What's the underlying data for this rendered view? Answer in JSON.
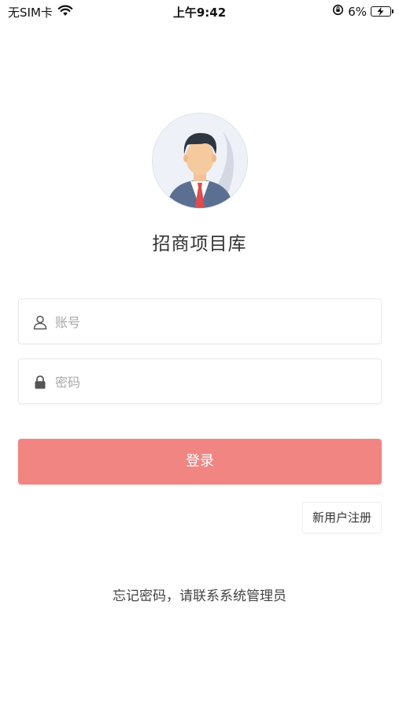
{
  "status_bar": {
    "carrier": "无SIM卡",
    "time": "上午9:42",
    "battery": "6%",
    "icons": [
      "wifi-icon",
      "orientation-lock-icon",
      "battery-charging-icon"
    ]
  },
  "app": {
    "title": "招商项目库",
    "avatar_icon": "user-avatar-icon"
  },
  "form": {
    "account": {
      "placeholder": "账号",
      "value": "",
      "icon": "user-icon"
    },
    "password": {
      "placeholder": "密码",
      "value": "",
      "icon": "lock-icon"
    },
    "login_label": "登录",
    "register_label": "新用户注册"
  },
  "footer": {
    "forgot_text": "忘记密码，请联系系统管理员"
  },
  "colors": {
    "accent": "#f08582",
    "placeholder": "#a8a8a8",
    "text": "#333333"
  }
}
